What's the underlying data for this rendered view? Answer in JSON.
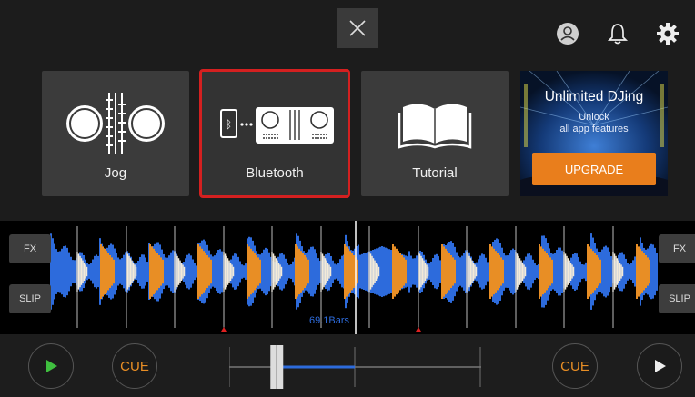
{
  "tiles": {
    "jog": {
      "label": "Jog"
    },
    "bluetooth": {
      "label": "Bluetooth"
    },
    "tutorial": {
      "label": "Tutorial"
    }
  },
  "promo": {
    "title": "Unlimited DJing",
    "subtitle_line1": "Unlock",
    "subtitle_line2": "all app features",
    "button_label": "UPGRADE"
  },
  "waveform": {
    "left_fx": "FX",
    "left_slip": "SLIP",
    "right_fx": "FX",
    "right_slip": "SLIP",
    "bars_readout": "69.1Bars"
  },
  "controls": {
    "left_cue": "CUE",
    "right_cue": "CUE",
    "crossfader_level": 0.2
  },
  "colors": {
    "accent_orange": "#e88e25",
    "accent_blue": "#2d6bdc",
    "selection_red": "#d42020",
    "play_green": "#3fbf3f"
  },
  "icons": [
    "close-icon",
    "account-icon",
    "bell-icon",
    "gear-icon",
    "play-icon"
  ]
}
